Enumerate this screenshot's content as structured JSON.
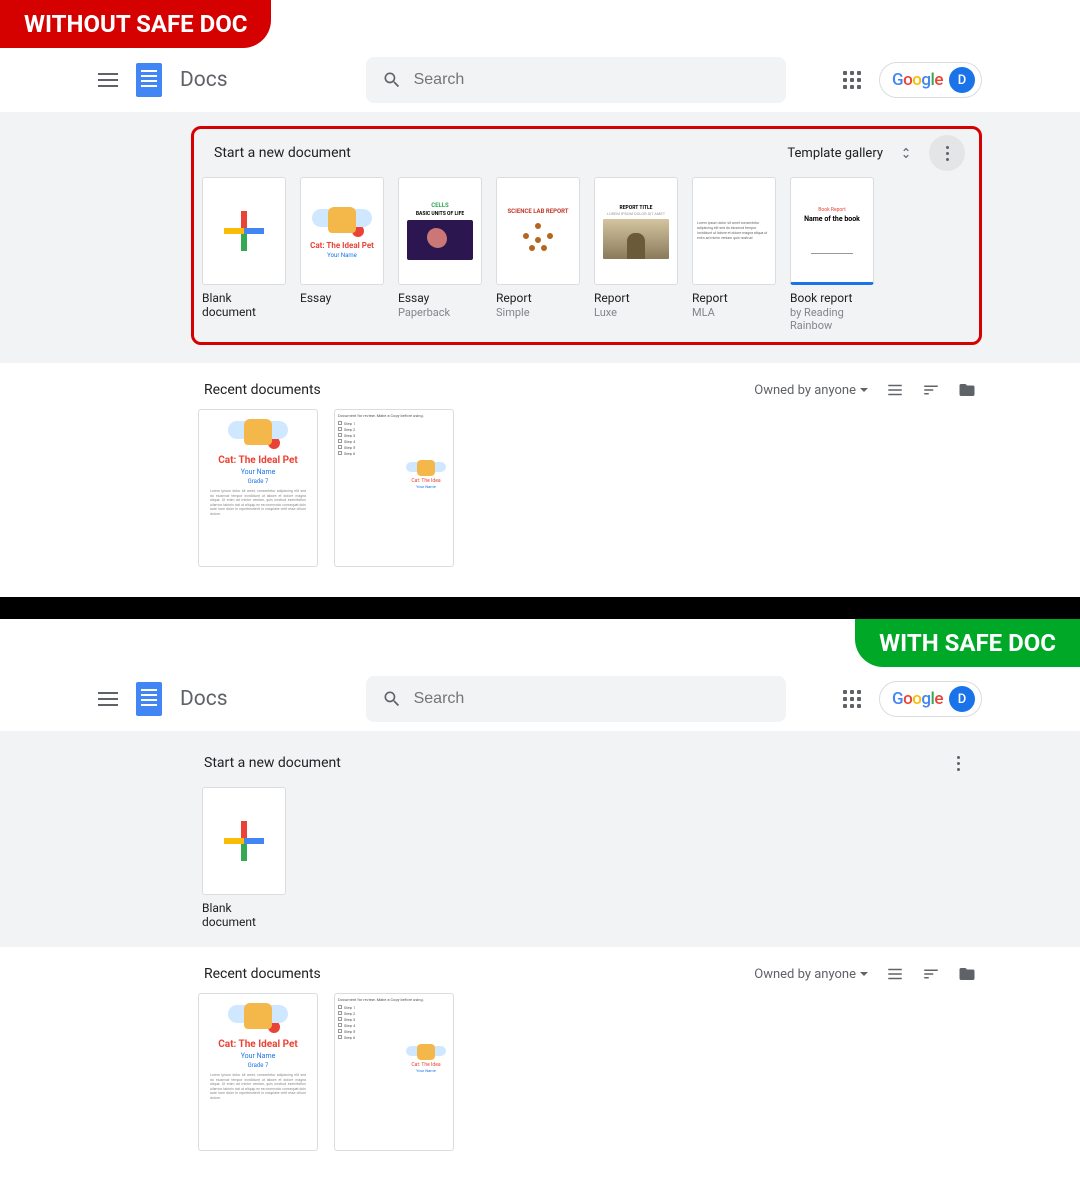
{
  "banners": {
    "without": "WITHOUT SAFE DOC",
    "with": "WITH SAFE DOC"
  },
  "header": {
    "app_name": "Docs",
    "search_placeholder": "Search",
    "avatar_letter": "D",
    "google": {
      "g": "G",
      "o1": "o",
      "o2": "o",
      "g2": "g",
      "l": "l",
      "e": "e"
    }
  },
  "templates": {
    "section_title": "Start a new document",
    "gallery_label": "Template gallery",
    "items": [
      {
        "label": "Blank document",
        "sub": ""
      },
      {
        "label": "Essay",
        "sub": ""
      },
      {
        "label": "Essay",
        "sub": "Paperback"
      },
      {
        "label": "Report",
        "sub": "Simple"
      },
      {
        "label": "Report",
        "sub": "Luxe"
      },
      {
        "label": "Report",
        "sub": "MLA"
      },
      {
        "label": "Book report",
        "sub": "by Reading Rainbow"
      }
    ]
  },
  "recent": {
    "title": "Recent documents",
    "owned_by": "Owned by anyone"
  },
  "thumbs": {
    "cat_title": "Cat: The Ideal Pet",
    "cat_author": "Your Name",
    "cat_grade": "Grade 7",
    "bio_kicker": "CELLS",
    "bio_title": "BASIC UNITS OF LIFE",
    "sci_title": "SCIENCE LAB REPORT",
    "luxe_title": "REPORT TITLE",
    "luxe_sub": "LOREM IPSUM DOLOR SIT AMET",
    "book_kicker": "Book Report",
    "book_title": "Name of the book",
    "cat_title_short": "Cat: The Idea"
  }
}
